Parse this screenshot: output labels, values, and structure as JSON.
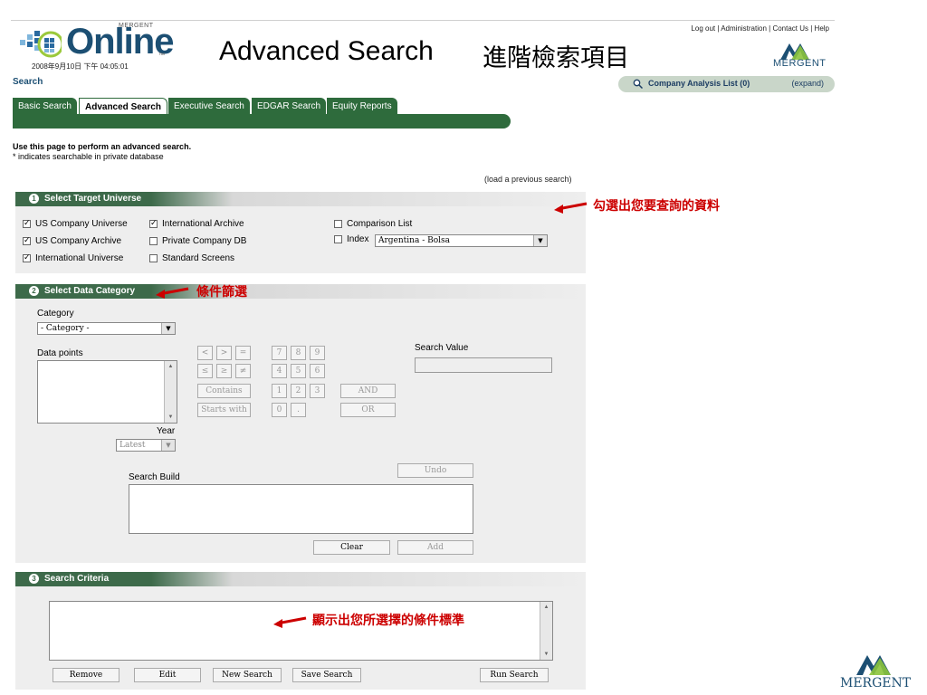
{
  "header": {
    "logo_brand": "Online",
    "logo_merg": "MERGENT",
    "logo_tm": "™",
    "logo_date": "2008年9月10日 下午 04:05:01",
    "title": "Advanced Search",
    "title_cn": "進階檢索項目",
    "links": [
      "Log out",
      "Administration",
      "Contact Us",
      "Help"
    ],
    "brand_right": "MERGENT"
  },
  "section_label": "Search",
  "company_list": {
    "label": "Company Analysis List (0)",
    "expand": "(expand)"
  },
  "tabs": [
    {
      "label": "Basic Search",
      "active": false
    },
    {
      "label": "Advanced Search",
      "active": true
    },
    {
      "label": "Executive Search",
      "active": false
    },
    {
      "label": "EDGAR Search",
      "active": false
    },
    {
      "label": "Equity Reports",
      "active": false
    }
  ],
  "intro": {
    "line1": "Use this page to perform an advanced search.",
    "line2": "* indicates searchable in private database",
    "load_previous": "(load a previous search)"
  },
  "panel1": {
    "num": "1",
    "title": "Select Target Universe",
    "annotation": "勾選出您要查詢的資料",
    "checkboxes": [
      {
        "label": "US Company Universe",
        "checked": true
      },
      {
        "label": "International Archive",
        "checked": true
      },
      {
        "label": "Comparison List",
        "checked": false
      },
      {
        "label": "US Company Archive",
        "checked": true
      },
      {
        "label": "Private Company DB",
        "checked": false
      },
      {
        "label": "Index",
        "checked": false
      },
      {
        "label": "International Universe",
        "checked": true
      },
      {
        "label": "Standard Screens",
        "checked": false
      }
    ],
    "index_select": "Argentina - Bolsa"
  },
  "panel2": {
    "num": "2",
    "title": "Select Data Category",
    "annotation": "條件篩選",
    "category_label": "Category",
    "category_value": "- Category -",
    "datapoints_label": "Data points",
    "year_label": "Year",
    "year_value": "Latest",
    "search_value_label": "Search Value",
    "operators": [
      "<",
      ">",
      "=",
      "≤",
      "≥",
      "≠"
    ],
    "contains": "Contains",
    "starts_with": "Starts with",
    "digits": [
      "7",
      "8",
      "9",
      "4",
      "5",
      "6",
      "1",
      "2",
      "3",
      "0",
      "."
    ],
    "and": "AND",
    "or": "OR",
    "search_build_label": "Search Build",
    "undo": "Undo",
    "clear": "Clear",
    "add": "Add"
  },
  "panel3": {
    "num": "3",
    "title": "Search Criteria",
    "annotation": "顯示出您所選擇的條件標準",
    "buttons": [
      "Remove",
      "Edit",
      "New Search",
      "Save Search",
      "Run Search"
    ]
  },
  "footer_logo": "MERGENT",
  "colors": {
    "accent": "#2e6b3c",
    "brand": "#1c4f73",
    "annotation": "#cc0000"
  }
}
